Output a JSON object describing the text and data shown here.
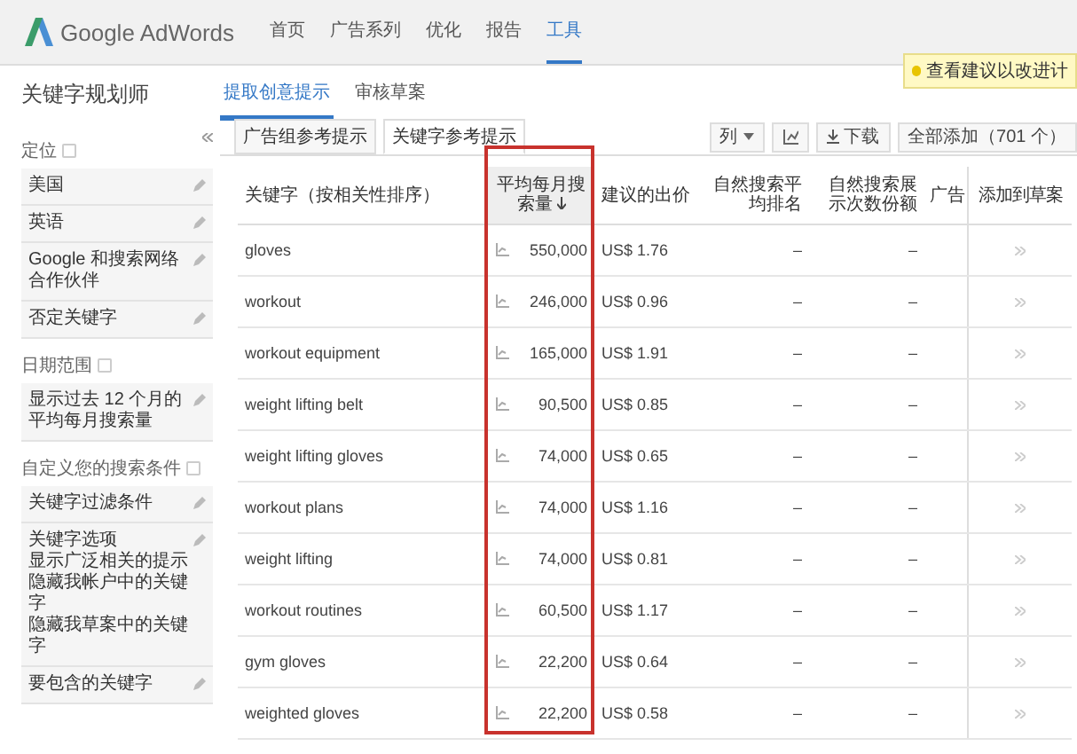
{
  "header": {
    "logo": "Google AdWords",
    "nav": [
      {
        "label": "首页",
        "selected": false
      },
      {
        "label": "广告系列",
        "selected": false
      },
      {
        "label": "优化",
        "selected": false
      },
      {
        "label": "报告",
        "selected": false
      },
      {
        "label": "工具",
        "selected": true
      }
    ]
  },
  "page_title": "关键字规划师",
  "page_tabs": [
    {
      "label": "提取创意提示",
      "selected": true
    },
    {
      "label": "审核草案",
      "selected": false
    }
  ],
  "tip": "查看建议以改进计",
  "sidebar": {
    "sections": [
      {
        "title": "定位",
        "items": [
          {
            "lines": [
              "美国"
            ]
          },
          {
            "lines": [
              "英语"
            ]
          },
          {
            "lines": [
              "Google 和搜索网络合作伙伴"
            ]
          },
          {
            "lines": [
              "否定关键字"
            ]
          }
        ]
      },
      {
        "title": "日期范围",
        "items": [
          {
            "lines": [
              "显示过去 12 个月的平均每月搜索量"
            ]
          }
        ]
      },
      {
        "title": "自定义您的搜索条件",
        "items": [
          {
            "lines": [
              "关键字过滤条件"
            ]
          },
          {
            "lines": [
              "关键字选项",
              "显示广泛相关的提示",
              "隐藏我帐户中的关键字",
              "隐藏我草案中的关键字"
            ]
          },
          {
            "lines": [
              "要包含的关键字"
            ]
          }
        ]
      }
    ]
  },
  "sub_tabs": [
    {
      "label": "广告组参考提示",
      "selected": false
    },
    {
      "label": "关键字参考提示",
      "selected": true
    }
  ],
  "toolbar": {
    "columns": "列",
    "download": "下载",
    "add_all": "全部添加（701 个）"
  },
  "table": {
    "columns": [
      {
        "label": "关键字（按相关性排序）",
        "sorted": false
      },
      {
        "label": "平均每月搜索量",
        "sorted": true
      },
      {
        "label": "建议的出价",
        "sorted": false
      },
      {
        "label": "自然搜索平均排名",
        "sorted": false
      },
      {
        "label": "自然搜索展示次数份额",
        "sorted": false
      },
      {
        "label": "广告",
        "sorted": false
      },
      {
        "label": "添加到草案",
        "sorted": false
      }
    ],
    "rows": [
      {
        "keyword": "gloves",
        "searches": "550,000",
        "bid": "US$ 1.76",
        "rank": "–",
        "share": "–"
      },
      {
        "keyword": "workout",
        "searches": "246,000",
        "bid": "US$ 0.96",
        "rank": "–",
        "share": "–"
      },
      {
        "keyword": "workout equipment",
        "searches": "165,000",
        "bid": "US$ 1.91",
        "rank": "–",
        "share": "–"
      },
      {
        "keyword": "weight lifting belt",
        "searches": "90,500",
        "bid": "US$ 0.85",
        "rank": "–",
        "share": "–"
      },
      {
        "keyword": "weight lifting gloves",
        "searches": "74,000",
        "bid": "US$ 0.65",
        "rank": "–",
        "share": "–"
      },
      {
        "keyword": "workout plans",
        "searches": "74,000",
        "bid": "US$ 1.16",
        "rank": "–",
        "share": "–"
      },
      {
        "keyword": "weight lifting",
        "searches": "74,000",
        "bid": "US$ 0.81",
        "rank": "–",
        "share": "–"
      },
      {
        "keyword": "workout routines",
        "searches": "60,500",
        "bid": "US$ 1.17",
        "rank": "–",
        "share": "–"
      },
      {
        "keyword": "gym gloves",
        "searches": "22,200",
        "bid": "US$ 0.64",
        "rank": "–",
        "share": "–"
      },
      {
        "keyword": "weighted gloves",
        "searches": "22,200",
        "bid": "US$ 0.58",
        "rank": "–",
        "share": "–"
      }
    ]
  }
}
